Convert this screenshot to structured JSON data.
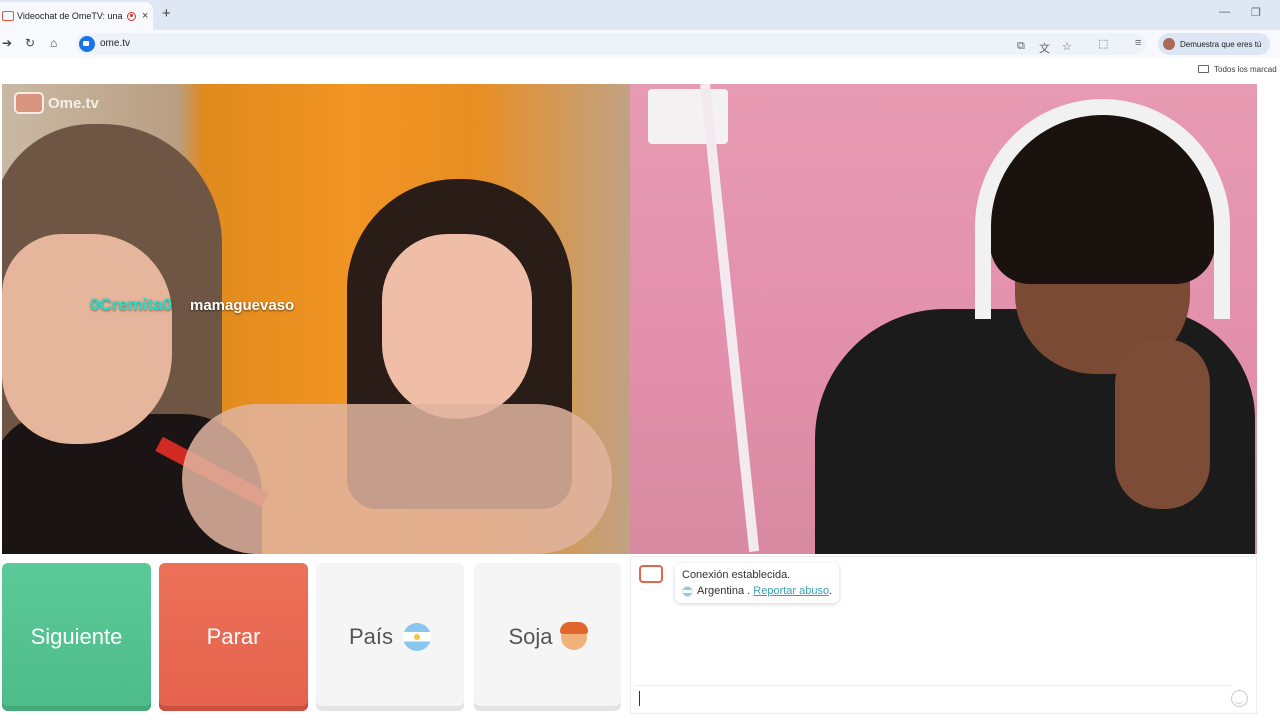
{
  "browser": {
    "tab_title": "Videochat de OmeTV: una",
    "tab_close": "×",
    "new_tab": "+",
    "minimize": "—",
    "maximize": "❐",
    "url": "ome.tv",
    "profile_label": "Demuestra que eres tú",
    "bookmarks_label": "Todos los marcad"
  },
  "video": {
    "logo_text": "Ome.tv",
    "stranger_names": [
      "0Cremita0",
      "mamaguevaso"
    ]
  },
  "controls": {
    "next_label": "Siguiente",
    "stop_label": "Parar",
    "country_label": "País",
    "gender_label": "Soja",
    "colors": {
      "next": "#5cc998",
      "stop": "#ec7058",
      "neutral": "#f5f5f5"
    }
  },
  "chat": {
    "status": "Conexión establecida.",
    "country": "Argentina",
    "separator": " . ",
    "report_link": "Reportar abuso",
    "trailing": ".",
    "input_value": ""
  }
}
